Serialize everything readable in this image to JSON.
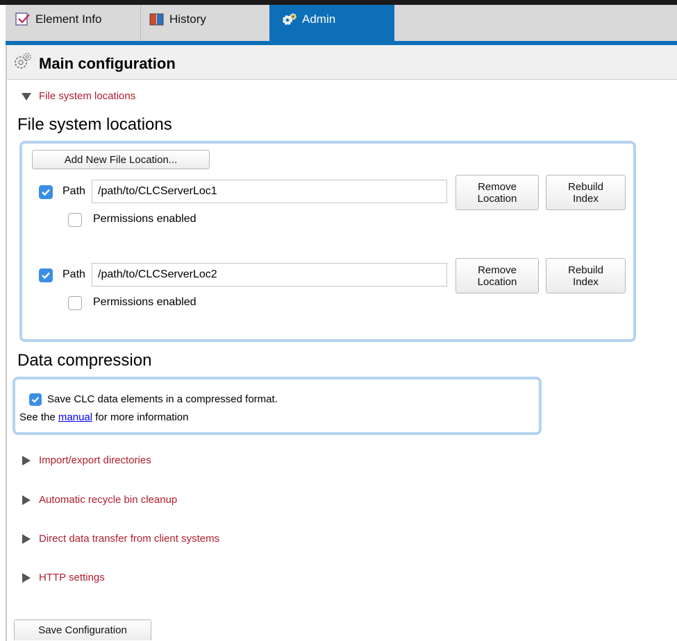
{
  "tabs": [
    {
      "label": "Element Info",
      "icon": "element-info-icon"
    },
    {
      "label": "History",
      "icon": "history-icon"
    },
    {
      "label": "Admin",
      "icon": "admin-gears-icon",
      "active": true
    }
  ],
  "header": {
    "title": "Main configuration",
    "icon": "gears-icon"
  },
  "file_locations": {
    "toggle_label": "File system locations",
    "heading": "File system locations",
    "add_button": "Add New File Location...",
    "locations": [
      {
        "checked": true,
        "path_label": "Path",
        "path": "/path/to/CLCServerLoc1",
        "permissions_label": "Permissions enabled",
        "permissions_checked": false,
        "remove_label_1": "Remove",
        "remove_label_2": "Location",
        "rebuild_label_1": "Rebuild",
        "rebuild_label_2": "Index"
      },
      {
        "checked": true,
        "path_label": "Path",
        "path": "/path/to/CLCServerLoc2",
        "permissions_label": "Permissions enabled",
        "permissions_checked": false,
        "remove_label_1": "Remove",
        "remove_label_2": "Location",
        "rebuild_label_1": "Rebuild",
        "rebuild_label_2": "Index"
      }
    ]
  },
  "compression": {
    "heading": "Data compression",
    "checked": true,
    "option_label": "Save CLC data elements in a compressed format.",
    "info_prefix": "See the",
    "info_link": "manual",
    "info_suffix": "for more information"
  },
  "collapsed_sections": [
    "Import/export directories",
    "Automatic recycle bin cleanup",
    "Direct data transfer from client systems",
    "HTTP settings"
  ],
  "save_button": "Save Configuration",
  "colors": {
    "accent": "#0d6fb8",
    "link_red": "#b01d2c",
    "checkbox_blue": "#3a8ee6",
    "box_border": "#b5d3ef"
  }
}
